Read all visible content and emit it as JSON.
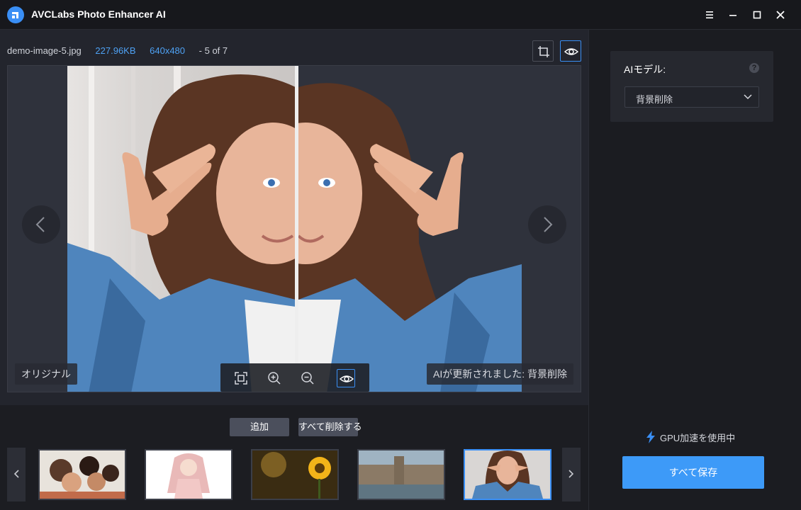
{
  "app": {
    "title": "AVCLabs Photo Enhancer AI"
  },
  "file": {
    "name": "demo-image-5.jpg",
    "size": "227.96KB",
    "resolution": "640x480",
    "position": "- 5 of 7"
  },
  "viewer": {
    "label_original": "オリジナル",
    "label_processed": "AIが更新されました: 背景削除"
  },
  "bottom": {
    "add_label": "追加",
    "delete_all_label": "すべて削除する"
  },
  "side": {
    "model_label": "AIモデル:",
    "help_mark": "?",
    "model_value": "背景削除",
    "gpu_label": "GPU加速を使用中",
    "save_all_label": "すべて保存"
  },
  "colors": {
    "accent": "#3a8ff5",
    "save": "#3d9af8",
    "bg": "#1b1c21",
    "viewer_bg": "#2f323c"
  }
}
